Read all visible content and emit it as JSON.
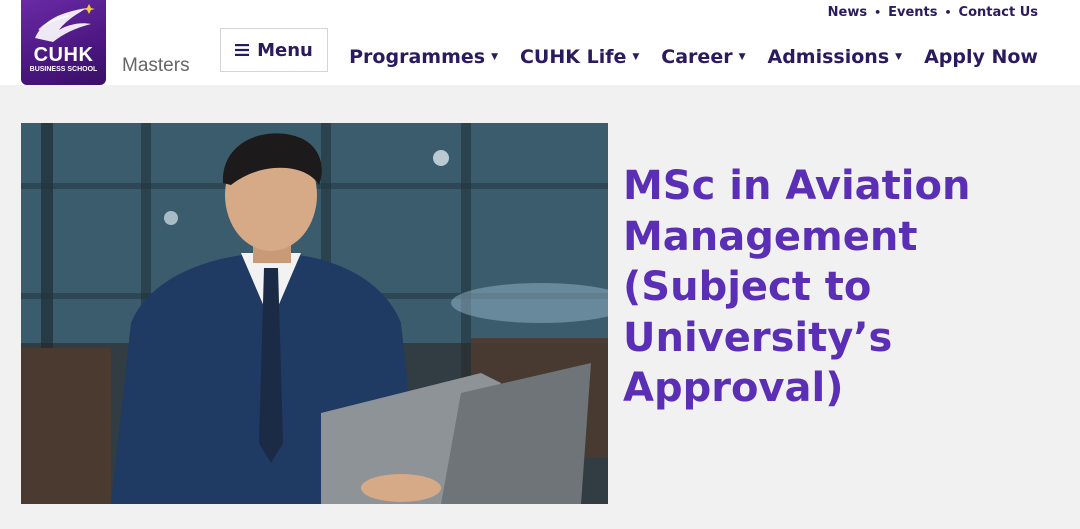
{
  "brand": {
    "logo_text": "CUHK",
    "logo_subtext": "BUSINESS SCHOOL",
    "section": "Masters",
    "primary_color": "#5b2fb5",
    "logo_color": "#4b1780",
    "nav_color": "#2a1a5e"
  },
  "header": {
    "menu_label": "Menu",
    "menu_icon": "hamburger-icon",
    "utility_links": [
      "News",
      "Events",
      "Contact Us"
    ],
    "nav": [
      {
        "label": "Programmes",
        "has_dropdown": true
      },
      {
        "label": "CUHK Life",
        "has_dropdown": true
      },
      {
        "label": "Career",
        "has_dropdown": true
      },
      {
        "label": "Admissions",
        "has_dropdown": true
      },
      {
        "label": "Apply Now",
        "has_dropdown": false
      }
    ]
  },
  "hero": {
    "title": "MSc in Aviation Management (Subject to University’s Approval)",
    "image": "man-in-suit-using-laptop-photo"
  }
}
